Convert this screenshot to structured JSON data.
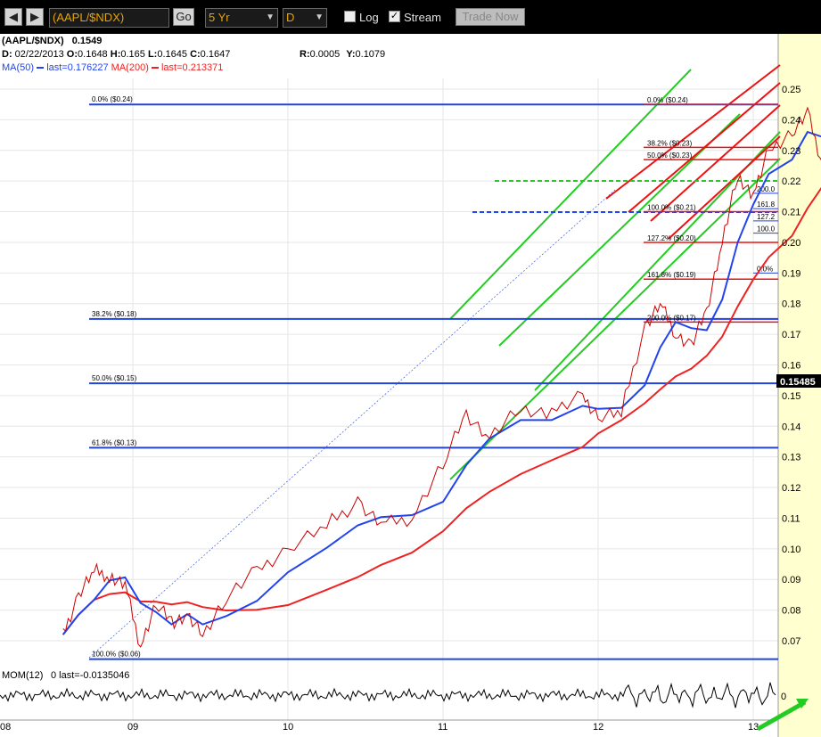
{
  "toolbar": {
    "symbol_value": "(AAPL/$NDX)",
    "go_label": "Go",
    "period_value": "5 Yr",
    "interval_value": "D",
    "log_label": "Log",
    "stream_label": "Stream",
    "stream_checked": true,
    "trade_label": "Trade Now"
  },
  "header": {
    "symbol": "(AAPL/$NDX)",
    "last": "0.1549",
    "date_label": "D:",
    "date": "02/22/2013",
    "open_label": "O:",
    "open": "0.1648",
    "high_label": "H:",
    "high": "0.165",
    "low_label": "L:",
    "low": "0.1645",
    "close_label": "C:",
    "close": "0.1647",
    "r_label": "R:",
    "r": "0.0005",
    "y_label": "Y:",
    "y": "0.1079",
    "ma50_label": "MA(50)",
    "ma50_last": "last=0.176227",
    "ma200_label": "MA(200)",
    "ma200_last": "last=0.213371"
  },
  "colors": {
    "background": "#ffffff",
    "right_axis": "#ffffd0",
    "price": "#cc0000",
    "ma50": "#2244ee",
    "ma200": "#ee2222",
    "fib_blue": "#2244dd",
    "channel_green": "#22cc22",
    "channel_red": "#ee1111"
  },
  "chart_data": {
    "type": "line",
    "price_axis": {
      "ticks": [
        "0.25",
        "0.24",
        "0.23",
        "0.22",
        "0.21",
        "0.20",
        "0.19",
        "0.18",
        "0.17",
        "0.16",
        "0.15",
        "0.14",
        "0.13",
        "0.12",
        "0.11",
        "0.10",
        "0.09",
        "0.08",
        "0.07"
      ],
      "last_price_label": "0.15485"
    },
    "x_ticks": [
      "08",
      "09",
      "10",
      "11",
      "12",
      "13"
    ],
    "price_series_approx": [
      {
        "x": "2008.55",
        "y": 0.072
      },
      {
        "x": "2008.65",
        "y": 0.085
      },
      {
        "x": "2008.75",
        "y": 0.093
      },
      {
        "x": "2008.85",
        "y": 0.091
      },
      {
        "x": "2008.95",
        "y": 0.088
      },
      {
        "x": "2009.05",
        "y": 0.068
      },
      {
        "x": "2009.15",
        "y": 0.082
      },
      {
        "x": "2009.25",
        "y": 0.076
      },
      {
        "x": "2009.35",
        "y": 0.078
      },
      {
        "x": "2009.45",
        "y": 0.072
      },
      {
        "x": "2009.6",
        "y": 0.084
      },
      {
        "x": "2009.8",
        "y": 0.093
      },
      {
        "x": "2010.0",
        "y": 0.1
      },
      {
        "x": "2010.25",
        "y": 0.108
      },
      {
        "x": "2010.45",
        "y": 0.115
      },
      {
        "x": "2010.6",
        "y": 0.108
      },
      {
        "x": "2010.8",
        "y": 0.11
      },
      {
        "x": "2011.0",
        "y": 0.128
      },
      {
        "x": "2011.15",
        "y": 0.144
      },
      {
        "x": "2011.3",
        "y": 0.136
      },
      {
        "x": "2011.5",
        "y": 0.146
      },
      {
        "x": "2011.7",
        "y": 0.144
      },
      {
        "x": "2011.9",
        "y": 0.15
      },
      {
        "x": "2012.0",
        "y": 0.143
      },
      {
        "x": "2012.15",
        "y": 0.145
      },
      {
        "x": "2012.3",
        "y": 0.172
      },
      {
        "x": "2012.4",
        "y": 0.18
      },
      {
        "x": "2012.5",
        "y": 0.17
      },
      {
        "x": "2012.6",
        "y": 0.166
      },
      {
        "x": "2012.7",
        "y": 0.178
      },
      {
        "x": "2012.8",
        "y": 0.2
      },
      {
        "x": "2012.9",
        "y": 0.222
      },
      {
        "x": "2013.0",
        "y": 0.215
      },
      {
        "x": "2013.1",
        "y": 0.23
      },
      {
        "x": "2013.25",
        "y": 0.236
      },
      {
        "x": "2013.35",
        "y": 0.242
      },
      {
        "x": "2013.45",
        "y": 0.225
      },
      {
        "x": "2013.55",
        "y": 0.205
      },
      {
        "x": "2013.65",
        "y": 0.195
      },
      {
        "x": "2013.72",
        "y": 0.18
      },
      {
        "x": "2013.8",
        "y": 0.162
      },
      {
        "x": "2013.86",
        "y": 0.1549
      }
    ],
    "fib_levels": [
      {
        "label": "0.0% ($0.24)",
        "value": 0.245
      },
      {
        "label": "38.2% ($0.18)",
        "value": 0.175
      },
      {
        "label": "50.0% ($0.15)",
        "value": 0.154
      },
      {
        "label": "61.8% ($0.13)",
        "value": 0.133
      },
      {
        "label": "100.0% ($0.06)",
        "value": 0.064
      }
    ],
    "inner_fib_labels": [
      {
        "label": "0.0% ($0.24)",
        "value": 0.245
      },
      {
        "label": "38.2% ($0.23)",
        "value": 0.231
      },
      {
        "label": "50.0% ($0.23)",
        "value": 0.227
      },
      {
        "label": "100.0% ($0.21)",
        "value": 0.21
      },
      {
        "label": "127.2% ($0.20)",
        "value": 0.2
      },
      {
        "label": "161.8% ($0.19)",
        "value": 0.188
      },
      {
        "label": "200.0% ($0.17)",
        "value": 0.174
      },
      {
        "label": "200.0",
        "value": 0.216
      },
      {
        "label": "161.8",
        "value": 0.211
      },
      {
        "label": "127.2",
        "value": 0.207
      },
      {
        "label": "100.0",
        "value": 0.203
      },
      {
        "label": "0.0%",
        "value": 0.19
      }
    ],
    "momentum": {
      "label": "MOM(12)",
      "last": "0 last=-0.0135046",
      "zero_label": "0"
    }
  }
}
